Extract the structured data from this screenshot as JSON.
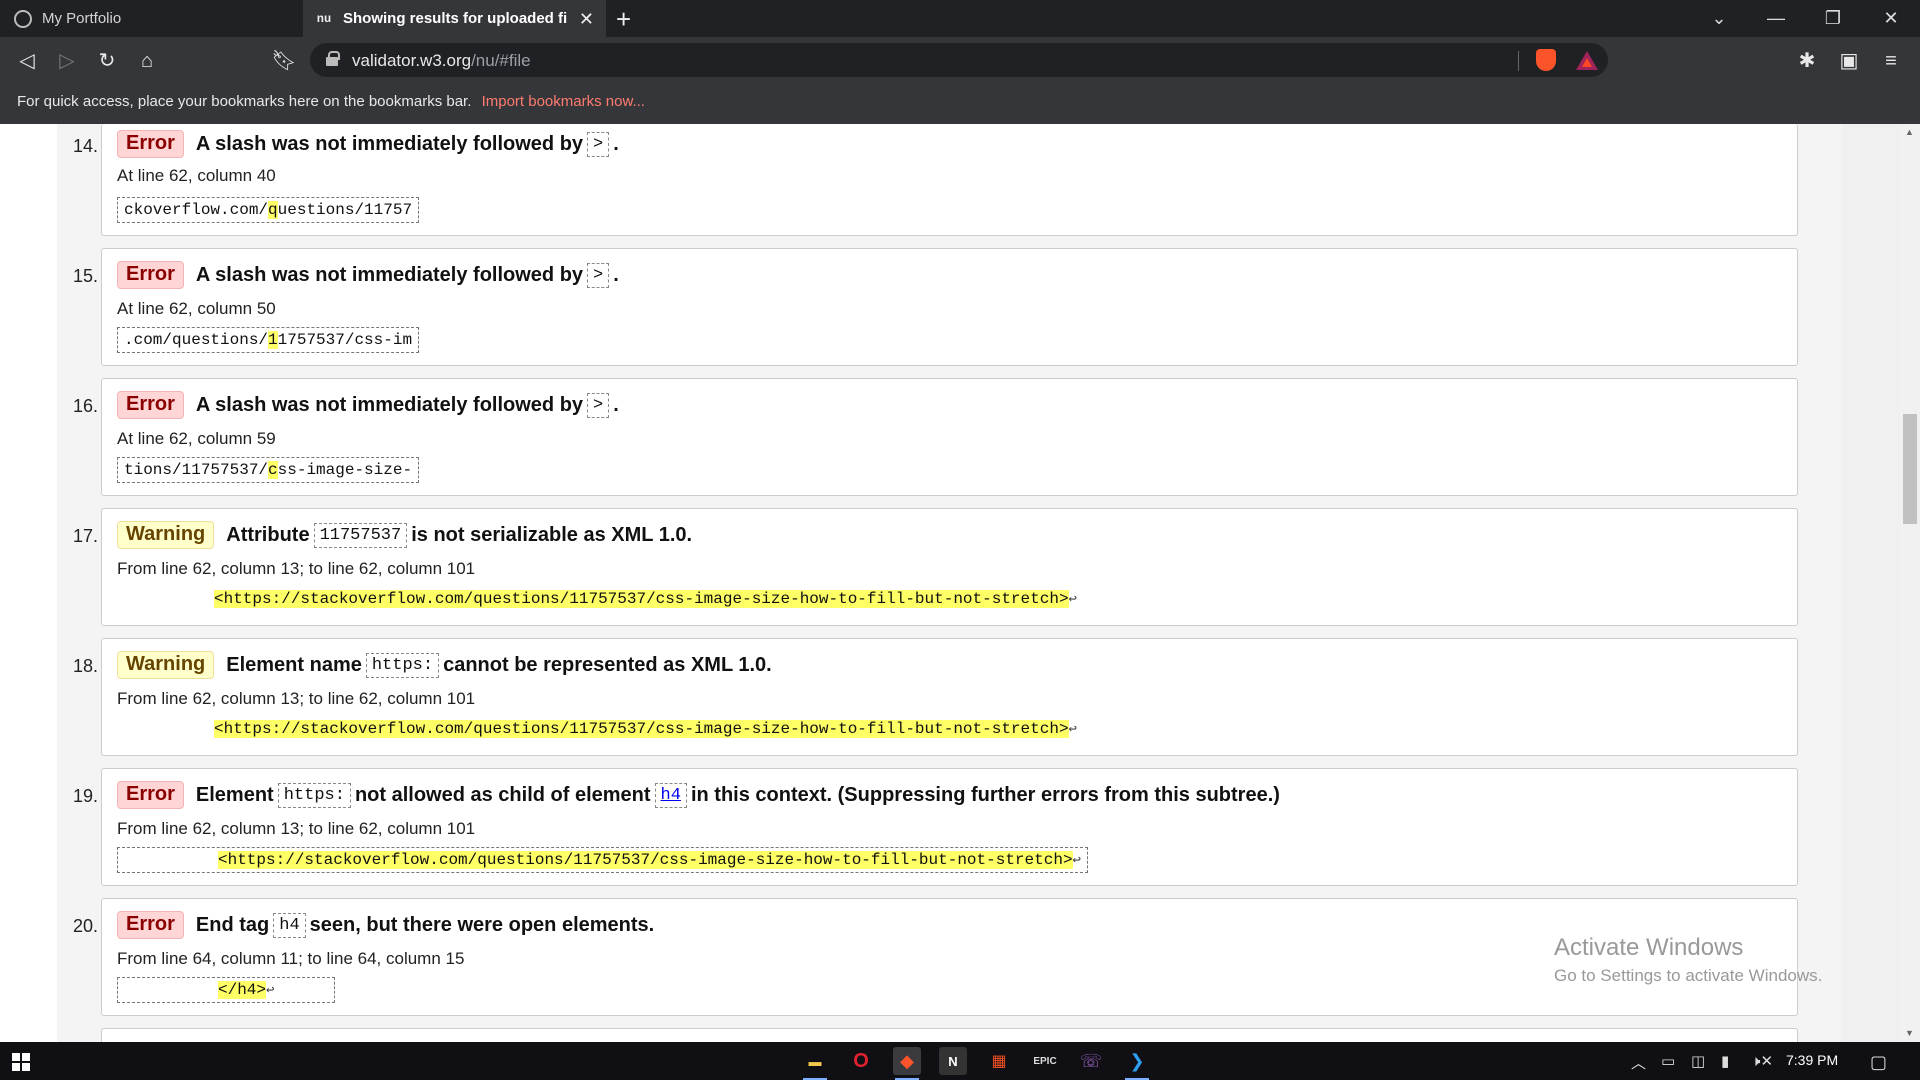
{
  "browser": {
    "tabs": [
      {
        "title": "My Portfolio",
        "icon": "globe-icon"
      },
      {
        "title": "Showing results for uploaded file",
        "icon": "nu-icon",
        "favicon_text": "nu"
      }
    ],
    "url": {
      "host": "validator.w3.org",
      "path": "/nu/#file"
    },
    "bookmark_bar": {
      "text": "For quick access, place your bookmarks here on the bookmarks bar.",
      "link": "Import bookmarks now..."
    }
  },
  "messages": [
    {
      "num": "14.",
      "type": "Error",
      "parts": [
        "A slash was not immediately followed by",
        ">",
        "."
      ],
      "location": "At line 62, column 40",
      "extract": {
        "before": "ckoverflow.com/",
        "hl": "q",
        "after": "uestions/11757"
      }
    },
    {
      "num": "15.",
      "type": "Error",
      "parts": [
        "A slash was not immediately followed by",
        ">",
        "."
      ],
      "location": "At line 62, column 50",
      "extract": {
        "before": ".com/questions/",
        "hl": "1",
        "after": "1757537/css-im"
      }
    },
    {
      "num": "16.",
      "type": "Error",
      "parts": [
        "A slash was not immediately followed by",
        ">",
        "."
      ],
      "location": "At line 62, column 59",
      "extract": {
        "before": "tions/11757537/",
        "hl": "c",
        "after": "ss-image-size-"
      }
    },
    {
      "num": "17.",
      "type": "Warning",
      "parts": [
        "Attribute",
        "11757537",
        "is not serializable as XML 1.0."
      ],
      "location": "From line 62, column 13; to line 62, column 101",
      "extract": {
        "before": "",
        "hl": "<https://stackoverflow.com/questions/11757537/css-image-size-how-to-fill-but-not-stretch>",
        "after": "↩"
      }
    },
    {
      "num": "18.",
      "type": "Warning",
      "parts": [
        "Element name",
        "https:",
        "cannot be represented as XML 1.0."
      ],
      "location": "From line 62, column 13; to line 62, column 101",
      "extract": {
        "before": "",
        "hl": "<https://stackoverflow.com/questions/11757537/css-image-size-how-to-fill-but-not-stretch>",
        "after": "↩"
      }
    },
    {
      "num": "19.",
      "type": "Error",
      "parts": [
        "Element",
        "https:",
        "not allowed as child of element",
        "h4",
        "in this context. (Suppressing further errors from this subtree.)"
      ],
      "location": "From line 62, column 13; to line 62, column 101",
      "extract": {
        "before": "",
        "hl": "<https://stackoverflow.com/questions/11757537/css-image-size-how-to-fill-but-not-stretch>",
        "after": "↩"
      }
    },
    {
      "num": "20.",
      "type": "Error",
      "parts": [
        "End tag",
        "h4",
        "seen, but there were open elements."
      ],
      "location": "From line 64, column 11; to line 64, column 15",
      "extract": {
        "before": "",
        "hl": "</h4>",
        "after": "↩"
      }
    }
  ],
  "watermark": {
    "line1": "Activate Windows",
    "line2": "Go to Settings to activate Windows."
  },
  "taskbar": {
    "time": "7:39 PM"
  }
}
